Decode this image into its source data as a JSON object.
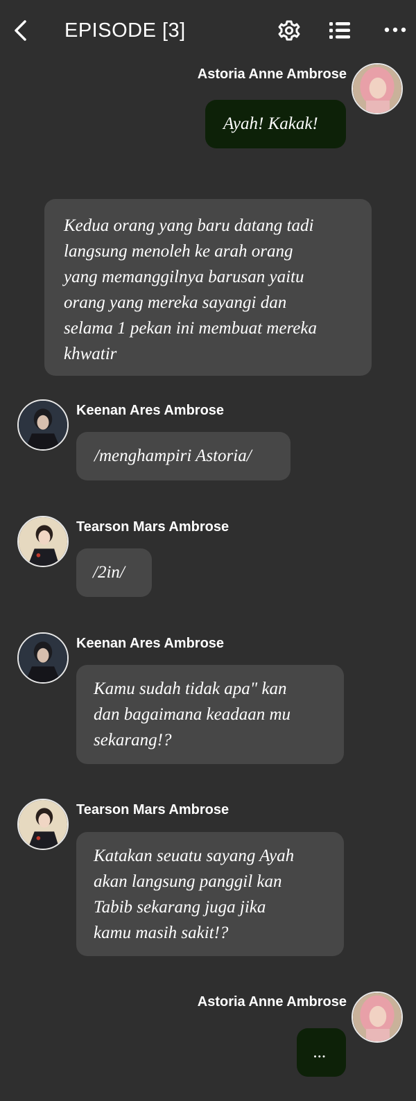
{
  "header": {
    "title": "EPISODE [3]",
    "icons": [
      "back-arrow-icon",
      "gear-icon",
      "list-icon",
      "more-dots-icon"
    ]
  },
  "messages": [
    {
      "kind": "me",
      "name": "Astoria Anne Ambrose",
      "avatar": "astoria-avatar",
      "lines": [
        "Ayah! Kakak!"
      ]
    },
    {
      "kind": "narration",
      "lines": [
        "Kedua orang yang baru datang tadi",
        "langsung menoleh ke arah orang",
        "yang memanggilnya barusan yaitu",
        "orang yang mereka sayangi dan",
        "selama 1 pekan ini membuat mereka",
        "khwatir"
      ]
    },
    {
      "kind": "npc",
      "name": "Keenan Ares Ambrose",
      "avatar": "keenan-avatar",
      "lines": [
        "/menghampiri Astoria/"
      ]
    },
    {
      "kind": "npc",
      "name": "Tearson Mars Ambrose",
      "avatar": "tearson-avatar",
      "lines": [
        "/2in/"
      ]
    },
    {
      "kind": "npc",
      "name": "Keenan Ares Ambrose",
      "avatar": "keenan-avatar",
      "lines": [
        "Kamu sudah tidak apa\" kan",
        "dan bagaimana keadaan mu",
        "sekarang!?"
      ]
    },
    {
      "kind": "npc",
      "name": "Tearson Mars Ambrose",
      "avatar": "tearson-avatar",
      "lines": [
        "Katakan seuatu sayang Ayah",
        "akan langsung panggil kan",
        "Tabib sekarang juga jika",
        "kamu masih sakit!?"
      ]
    },
    {
      "kind": "me",
      "name": "Astoria Anne Ambrose",
      "avatar": "astoria-avatar",
      "lines": [
        "..."
      ]
    }
  ],
  "colors": {
    "background": "#2f2f2f",
    "npc_bubble": "#474747",
    "my_bubble": "#0d2108"
  }
}
